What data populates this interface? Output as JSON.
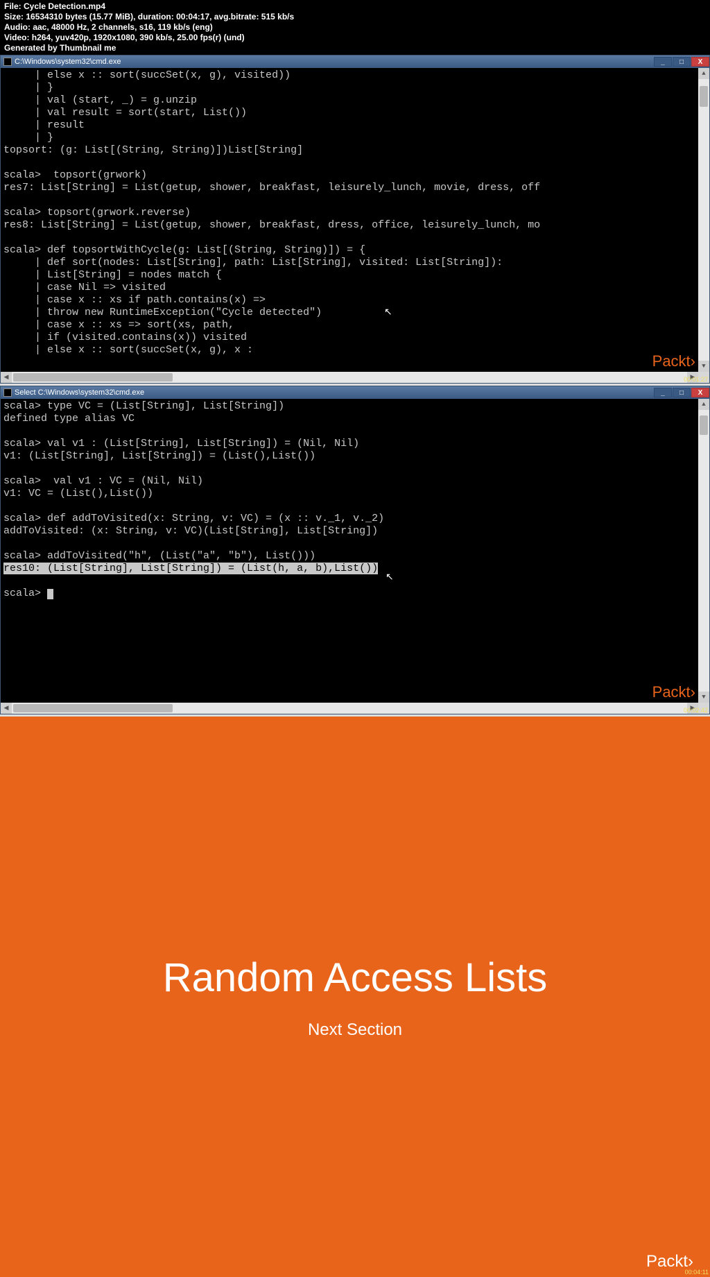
{
  "metadata": {
    "file": "File: Cycle Detection.mp4",
    "size": "Size: 16534310 bytes (15.77 MiB), duration: 00:04:17, avg.bitrate: 515 kb/s",
    "audio": "Audio: aac, 48000 Hz, 2 channels, s16, 119 kb/s (eng)",
    "video": "Video: h264, yuv420p, 1920x1080, 390 kb/s, 25.00 fps(r) (und)",
    "generated": "Generated by Thumbnail me"
  },
  "terminal1": {
    "title": "C:\\Windows\\system32\\cmd.exe",
    "content": "     | else x :: sort(succSet(x, g), visited))\n     | }\n     | val (start, _) = g.unzip\n     | val result = sort(start, List())\n     | result\n     | }\ntopsort: (g: List[(String, String)])List[String]\n\nscala>  topsort(grwork)\nres7: List[String] = List(getup, shower, breakfast, leisurely_lunch, movie, dress, off\n\nscala> topsort(grwork.reverse)\nres8: List[String] = List(getup, shower, breakfast, dress, office, leisurely_lunch, mo\n\nscala> def topsortWithCycle(g: List[(String, String)]) = {\n     | def sort(nodes: List[String], path: List[String], visited: List[String]):\n     | List[String] = nodes match {\n     | case Nil => visited\n     | case x :: xs if path.contains(x) =>\n     | throw new RuntimeException(\"Cycle detected\")\n     | case x :: xs => sort(xs, path,\n     | if (visited.contains(x)) visited\n     | else x :: sort(succSet(x, g), x :",
    "watermark": "Packt›",
    "timestamp": "00:01:27"
  },
  "terminal2": {
    "title": "Select C:\\Windows\\system32\\cmd.exe",
    "content_before": "scala> type VC = (List[String], List[String])\ndefined type alias VC\n\nscala> val v1 : (List[String], List[String]) = (Nil, Nil)\nv1: (List[String], List[String]) = (List(),List())\n\nscala>  val v1 : VC = (Nil, Nil)\nv1: VC = (List(),List())\n\nscala> def addToVisited(x: String, v: VC) = (x :: v._1, v._2)\naddToVisited: (x: String, v: VC)(List[String], List[String])\n\nscala> addToVisited(\"h\", (List(\"a\", \"b\"), List()))\n",
    "highlighted": "res10: (List[String], List[String]) = (List(h, a, b),List())",
    "content_after": "\n\nscala> ",
    "watermark": "Packt›",
    "timestamp": "00:02:42"
  },
  "slide": {
    "title": "Random Access Lists",
    "subtitle": "Next Section",
    "watermark": "Packt›",
    "timestamp": "00:04:11"
  },
  "win": {
    "min": "_",
    "max": "□",
    "close": "X"
  }
}
